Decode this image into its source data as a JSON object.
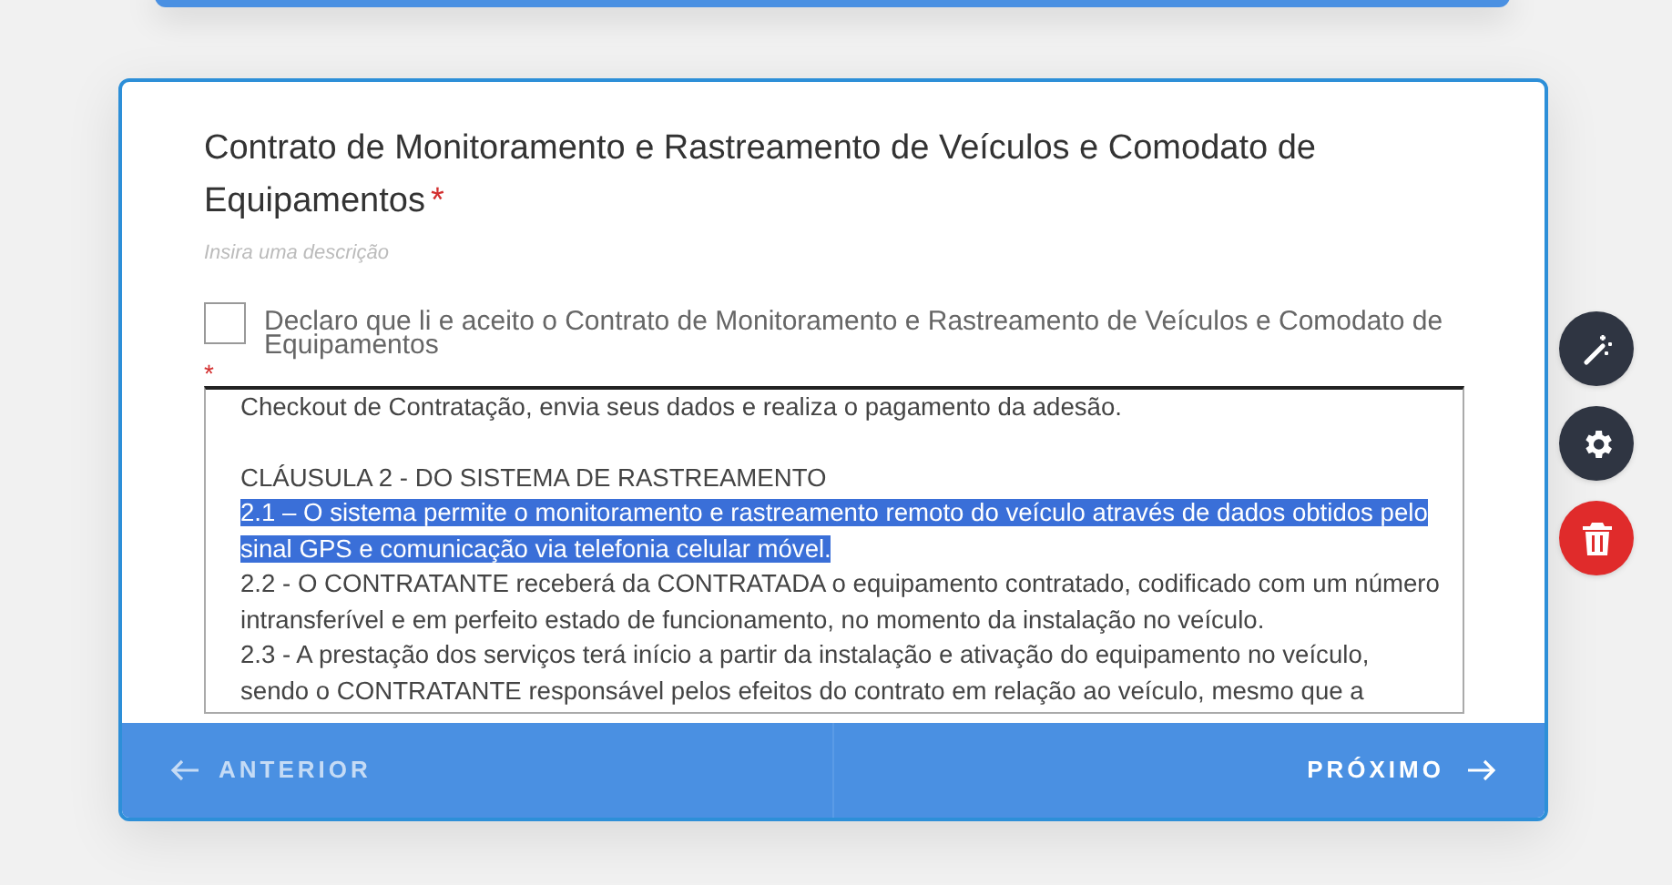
{
  "question": {
    "title": "Contrato de Monitoramento e Rastreamento de Veículos e Comodato de Equipamentos",
    "required_mark": "*",
    "description_placeholder": "Insira uma descrição"
  },
  "agreement": {
    "label": "Declaro que li e aceito o Contrato de Monitoramento e Rastreamento de Veículos e Comodato de Equipamentos",
    "checked": false,
    "required_mark": "*"
  },
  "contract_text": [
    {
      "text": "Checkout de Contratação, envia seus dados e realiza o pagamento da adesão.",
      "selected": false
    },
    {
      "text": "CLÁUSULA 2 - DO SISTEMA DE RASTREAMENTO",
      "kind": "clause_heading",
      "selected": false
    },
    {
      "text": "2.1 – O sistema permite o monitoramento e rastreamento remoto do veículo através de dados obtidos pelo sinal GPS e comunicação via telefonia celular móvel.",
      "selected": true
    },
    {
      "text": "2.2 - O CONTRATANTE receberá da CONTRATADA o equipamento contratado, codificado com um número intransferível e em perfeito estado de funcionamento, no momento da instalação no veículo.",
      "selected": false
    },
    {
      "text": "2.3 - A prestação dos serviços terá início a partir da instalação e ativação do equipamento no veículo, sendo o CONTRATANTE responsável pelos efeitos do contrato em relação ao veículo, mesmo que a",
      "selected": false
    }
  ],
  "navigation": [
    {
      "label": "ANTERIOR",
      "kind": "previous",
      "disabled": true
    },
    {
      "label": "PRÓXIMO",
      "kind": "next",
      "disabled": false
    }
  ],
  "side_tools": [
    {
      "kind": "magic"
    },
    {
      "kind": "settings"
    },
    {
      "kind": "delete"
    }
  ]
}
